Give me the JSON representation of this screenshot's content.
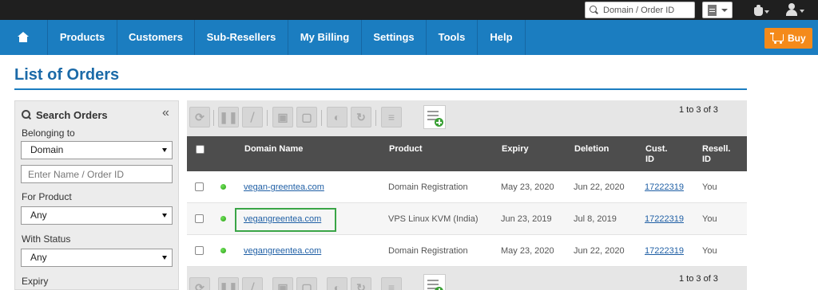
{
  "topbar": {
    "search_placeholder": "Domain / Order ID"
  },
  "nav": {
    "items": [
      "Products",
      "Customers",
      "Sub-Resellers",
      "My Billing",
      "Settings",
      "Tools",
      "Help"
    ],
    "buy_label": "Buy"
  },
  "page": {
    "title": "List of Orders"
  },
  "sidebar": {
    "heading": "Search Orders",
    "collapse_glyph": "«",
    "belonging_label": "Belonging to",
    "belonging_value": "Domain",
    "name_placeholder": "Enter Name / Order ID",
    "product_label": "For Product",
    "product_value": "Any",
    "status_label": "With Status",
    "status_value": "Any",
    "expiry_label": "Expiry"
  },
  "toolbar": {
    "pager": "1 to 3 of 3",
    "pager_bottom": "1 to 3 of 3"
  },
  "table": {
    "columns": {
      "domain": "Domain Name",
      "product": "Product",
      "expiry": "Expiry",
      "deletion": "Deletion",
      "cust_line1": "Cust.",
      "cust_line2": "ID",
      "resell_line1": "Resell.",
      "resell_line2": "ID"
    },
    "rows": [
      {
        "domain": "vegan-greentea.com",
        "product": "Domain Registration",
        "expiry": "May 23, 2020",
        "deletion": "Jun 22, 2020",
        "cust_id": "17222319",
        "resell_id": "You"
      },
      {
        "domain": "vegangreentea.com",
        "product": "VPS Linux KVM (India)",
        "expiry": "Jun 23, 2019",
        "deletion": "Jul 8, 2019",
        "cust_id": "17222319",
        "resell_id": "You"
      },
      {
        "domain": "vegangreentea.com",
        "product": "Domain Registration",
        "expiry": "May 23, 2020",
        "deletion": "Jun 22, 2020",
        "cust_id": "17222319",
        "resell_id": "You"
      }
    ]
  },
  "colors": {
    "nav_blue": "#1b7dc0",
    "buy_orange": "#f48a1a",
    "title_blue": "#1b6aa8",
    "status_green": "#2aa014",
    "highlight_green": "#3aa547"
  }
}
